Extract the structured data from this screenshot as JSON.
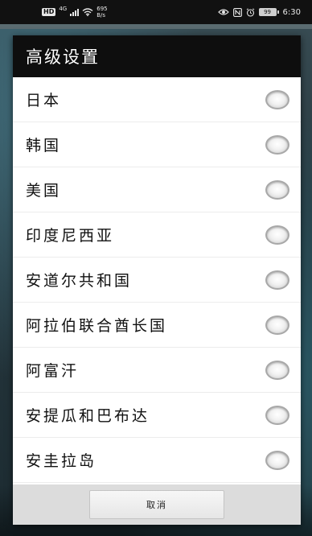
{
  "status_bar": {
    "hd_label": "HD",
    "network_type": "4G",
    "speed_value": "695",
    "speed_unit": "B/s",
    "battery": "99",
    "time": "6:30",
    "icons": [
      "hd-icon",
      "signal-icon",
      "wifi-icon",
      "eye-icon",
      "nfc-icon",
      "alarm-icon",
      "battery-icon"
    ]
  },
  "dialog": {
    "title": "高级设置",
    "options": [
      {
        "label": "日本",
        "selected": false
      },
      {
        "label": "韩国",
        "selected": false
      },
      {
        "label": "美国",
        "selected": false
      },
      {
        "label": "印度尼西亚",
        "selected": false
      },
      {
        "label": "安道尔共和国",
        "selected": false
      },
      {
        "label": "阿拉伯联合酋长国",
        "selected": false
      },
      {
        "label": "阿富汗",
        "selected": false
      },
      {
        "label": "安提瓜和巴布达",
        "selected": false
      },
      {
        "label": "安圭拉岛",
        "selected": false
      }
    ],
    "cancel_label": "取消"
  },
  "colors": {
    "title_bar": "#0e0e0e",
    "dialog_bg": "#ffffff",
    "footer_bg": "#dcdcdc"
  }
}
